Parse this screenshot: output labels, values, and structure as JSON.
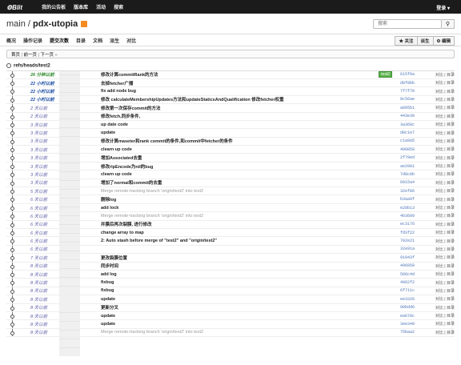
{
  "topbar": {
    "logo": "Blit",
    "nav": [
      "我的公告板",
      "版本库",
      "活动",
      "搜索"
    ],
    "login": "登录"
  },
  "header": {
    "repo_prefix": "main",
    "repo_name": "pdx-utopia",
    "search_placeholder": "搜索",
    "search_icon": "search-icon"
  },
  "tabs": [
    "概况",
    "操作记录",
    "提交次数",
    "目录",
    "文档",
    "派生",
    "对比"
  ],
  "actions": [
    "★ 关注",
    "派生",
    "⚙ 编辑"
  ],
  "pager": {
    "first": "首页",
    "prev": "前一页",
    "next": "下一页"
  },
  "ref": "refs/heads/test2",
  "rows": [
    {
      "date": "26 分钟以前",
      "type": "recent",
      "msg": "修改计算commitRank的方法",
      "tag": "test2",
      "sha": "615f9a"
    },
    {
      "date": "22 小时以前",
      "type": "hour",
      "msg": "去掉fetcher广播",
      "sha": "d8f8bb"
    },
    {
      "date": "22 小时以前",
      "type": "hour",
      "msg": "fix add node bug",
      "sha": "7f7f78"
    },
    {
      "date": "22 小时以前",
      "type": "hour",
      "msg": "修改 calculateMembershipUpdates方法和updateStaticsAndQualification 修改fetcher权重",
      "sha": "8c56ae"
    },
    {
      "date": "2 天以前",
      "type": "day",
      "msg": "修改第一次保存commit的方法",
      "sha": "a895b1"
    },
    {
      "date": "2 天以前",
      "type": "day",
      "msg": "修改fetch,同步条件,",
      "sha": "443e39"
    },
    {
      "date": "3 天以前",
      "type": "day",
      "msg": "up date code",
      "sha": "3a368c"
    },
    {
      "date": "3 天以前",
      "type": "day",
      "msg": "update",
      "sha": "d8c1e7"
    },
    {
      "date": "3 天以前",
      "type": "day",
      "msg": "修改计算maseter和rank commit的条件,和commit中fetcher的条件",
      "sha": "c1a9a5"
    },
    {
      "date": "3 天以前",
      "type": "day",
      "msg": "clearn up code",
      "sha": "490858"
    },
    {
      "date": "3 天以前",
      "type": "day",
      "msg": "增加Associated去重",
      "sha": "2f79ed"
    },
    {
      "date": "3 天以前",
      "type": "day",
      "msg": "修改rlpEncode为nil的bug",
      "sha": "ae2001"
    },
    {
      "date": "3 天以前",
      "type": "day",
      "msg": "clearn up code",
      "sha": "7d8c8b"
    },
    {
      "date": "3 天以前",
      "type": "day",
      "msg": "增加了normal和commit的去重",
      "sha": "6015a4"
    },
    {
      "date": "5 天以前",
      "type": "day",
      "msg": "Merge remote-tracking branch 'origin/test2' into test2",
      "merge": true,
      "sha": "32ef86"
    },
    {
      "date": "6 天以前",
      "type": "day",
      "msg": "删除log",
      "sha": "b3aa9f"
    },
    {
      "date": "6 天以前",
      "type": "day",
      "msg": "add lock",
      "sha": "e28b13"
    },
    {
      "date": "6 天以前",
      "type": "day",
      "msg": "Merge remote-tracking branch 'origin/test2' into test2",
      "merge": true,
      "sha": "4b3609"
    },
    {
      "date": "6 天以前",
      "type": "day",
      "msg": "并膜后再次裂膜, 进行修改",
      "sha": "ec3176"
    },
    {
      "date": "6 天以前",
      "type": "day",
      "msg": "change array to map",
      "sha": "fd3f22"
    },
    {
      "date": "6 天以前",
      "type": "day",
      "msg": "2: Auto stash before merge of \"test2\" and \"origin/test2\"",
      "sha": "702e21"
    },
    {
      "date": "6 天以前",
      "type": "day",
      "msg": "",
      "sha": "32e91a"
    },
    {
      "date": "7 天以前",
      "type": "day",
      "msg": "更改裂膜位置",
      "sha": "91943f"
    },
    {
      "date": "8 天以前",
      "type": "day",
      "msg": "同步时间",
      "sha": "496058"
    },
    {
      "date": "8 天以前",
      "type": "day",
      "msg": "add log",
      "sha": "506c4d"
    },
    {
      "date": "8 天以前",
      "type": "day",
      "msg": "fixbug",
      "sha": "4062f2"
    },
    {
      "date": "8 天以前",
      "type": "day",
      "msg": "fixbug",
      "sha": "6f711c"
    },
    {
      "date": "8 天以前",
      "type": "day",
      "msg": "update",
      "sha": "ee3326"
    },
    {
      "date": "8 天以前",
      "type": "day",
      "msg": "更新分叉",
      "sha": "90bdd6"
    },
    {
      "date": "8 天以前",
      "type": "day",
      "msg": "update",
      "sha": "ea670c"
    },
    {
      "date": "8 天以前",
      "type": "day",
      "msg": "update",
      "sha": "3ee349"
    },
    {
      "date": "8 天以前",
      "type": "day",
      "msg": "Merge remote-tracking branch 'origin/test2' into test2",
      "merge": true,
      "sha": "75baa2"
    }
  ],
  "link_label": "对比 | 目录"
}
